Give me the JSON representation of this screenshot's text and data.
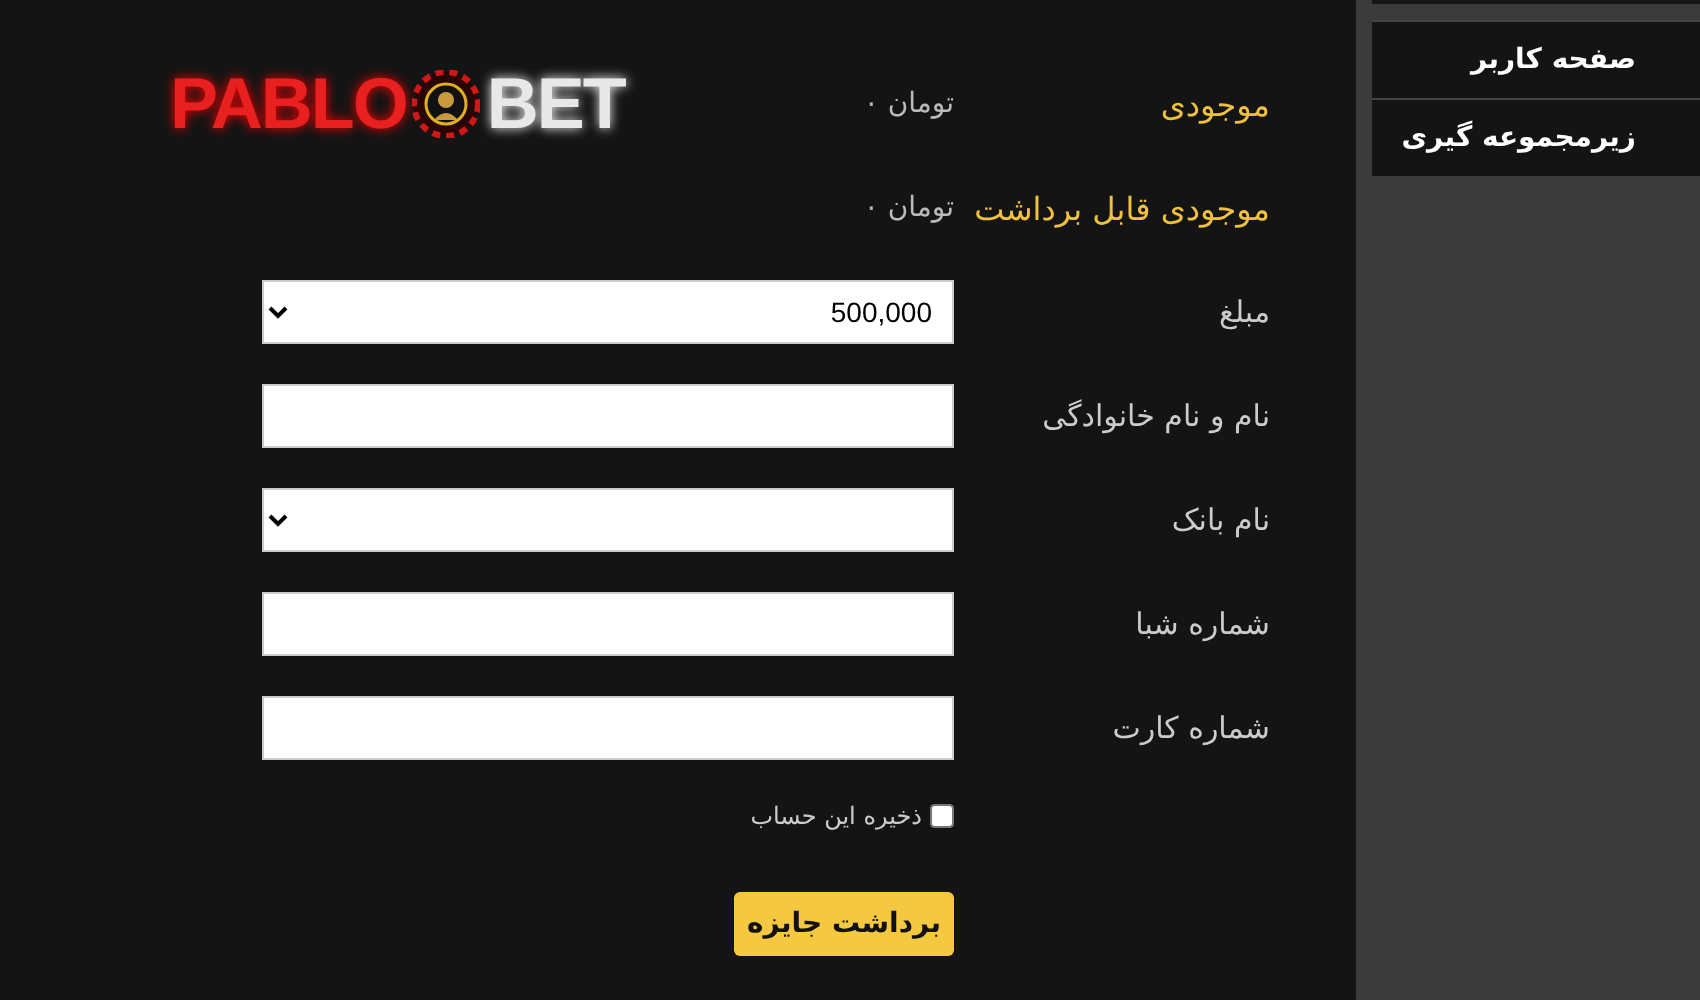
{
  "logo": {
    "left": "PABLO",
    "right": "BET"
  },
  "balances": [
    {
      "label": "موجودی",
      "value": "تومان ۰"
    },
    {
      "label": "موجودی قابل برداشت",
      "value": "تومان ۰"
    }
  ],
  "fields": [
    {
      "label": "مبلغ",
      "kind": "select",
      "value": "500,000"
    },
    {
      "label": "نام و نام خانوادگی",
      "kind": "text"
    },
    {
      "label": "نام بانک",
      "kind": "select"
    },
    {
      "label": "شماره شبا",
      "kind": "text"
    },
    {
      "label": "شماره کارت",
      "kind": "text"
    }
  ],
  "save_account": {
    "label": "ذخیره این حساب",
    "checked": false
  },
  "submit": "برداشت جایزه",
  "sidebar": {
    "items": [
      {
        "label": "صفحه کاربر"
      },
      {
        "label": "زیرمجموعه گیری"
      }
    ]
  }
}
